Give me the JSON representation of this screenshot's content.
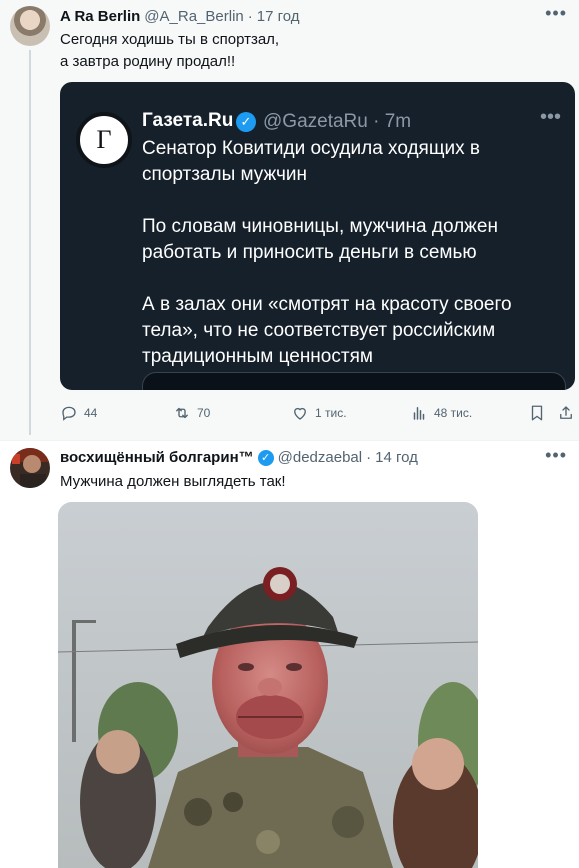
{
  "tweet1": {
    "name": "A Ra Berlin",
    "handle": "@A_Ra_Berlin",
    "separator": "·",
    "time": "17 год",
    "text_lines": [
      "Сегодня ходишь ты в спортзал,",
      "а завтра родину продал!!"
    ],
    "embed": {
      "avatar_letter": "Г",
      "name": "Газета.Ru",
      "handle_time": "@GazetaRu · 7m",
      "paragraphs": [
        "Сенатор Ковитиди осудила ходящих в спортзалы мужчин",
        "По словам чиновницы, мужчина должен работать и приносить деньги в семью",
        "А в залах они «смотрят на красоту своего тела», что не соответствует российским традиционным ценностям"
      ]
    },
    "actions": {
      "replies": "44",
      "retweets": "70",
      "likes": "1 тис.",
      "views": "48 тис."
    }
  },
  "tweet2": {
    "name": "восхищённый болгарин™",
    "handle": "@dedzaebal",
    "separator": "·",
    "time": "14 год",
    "text": "Мужчина должен выглядеть так!"
  },
  "colors": {
    "accent": "#1d9bf0",
    "secondary_text": "#536471",
    "embed_bg": "#15202b"
  }
}
